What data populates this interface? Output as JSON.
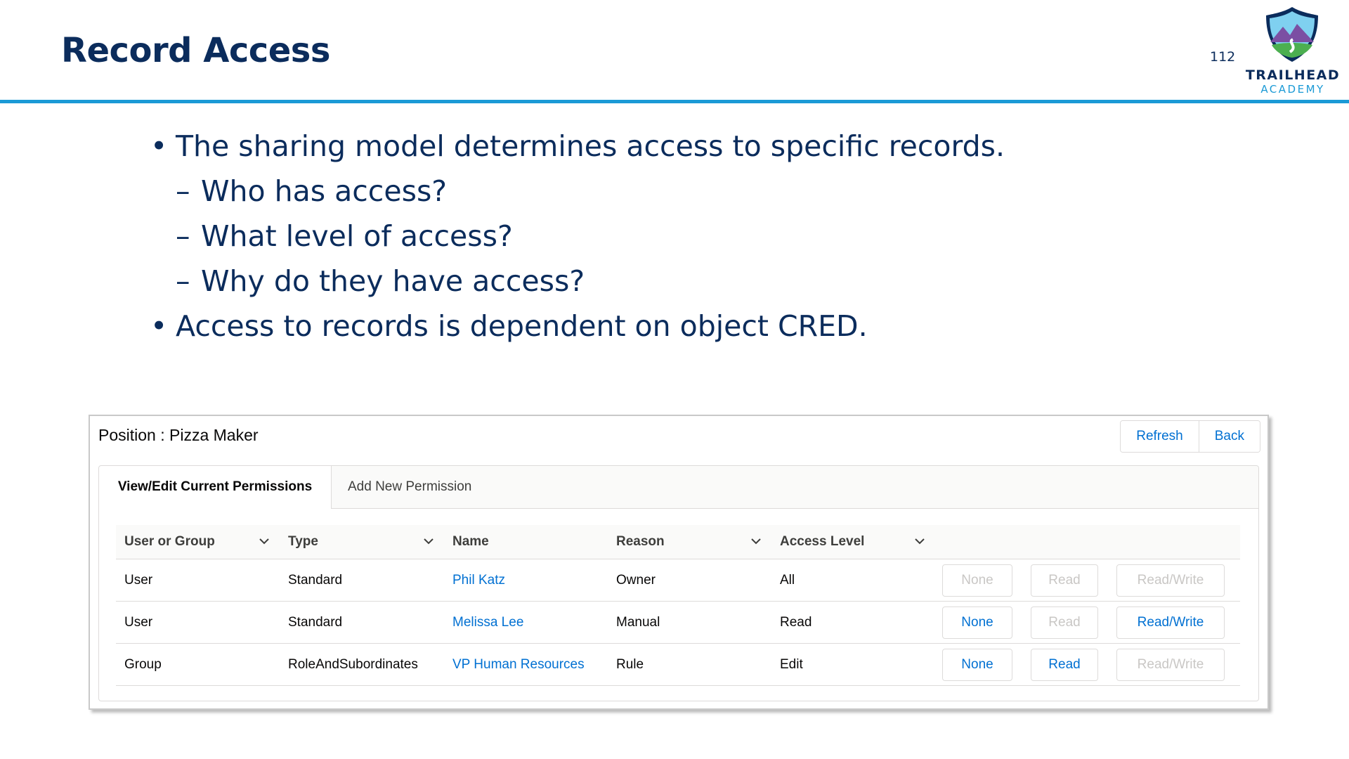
{
  "slide": {
    "title": "Record Access",
    "page_number": "112",
    "logo": {
      "line1": "TRAILHEAD",
      "line2": "ACADEMY",
      "icon": "trailhead-badge-icon"
    },
    "bullets": [
      {
        "level": 1,
        "marker": "•",
        "text": "The sharing model determines access to specific records."
      },
      {
        "level": 2,
        "marker": "–",
        "text": "Who has access?"
      },
      {
        "level": 2,
        "marker": "–",
        "text": "What level of access?"
      },
      {
        "level": 2,
        "marker": "–",
        "text": "Why do they have access?"
      },
      {
        "level": 1,
        "marker": "•",
        "text": "Access to records is dependent on object CRED."
      }
    ]
  },
  "panel": {
    "title": "Position : Pizza Maker",
    "buttons": {
      "refresh": "Refresh",
      "back": "Back"
    },
    "tabs": {
      "active": "View/Edit Current Permissions",
      "inactive": "Add New Permission"
    },
    "columns": [
      "User or Group",
      "Type",
      "Name",
      "Reason",
      "Access Level"
    ],
    "rows": [
      {
        "user_or_group": "User",
        "type": "Standard",
        "name": "Phil Katz",
        "reason": "Owner",
        "access_level": "All",
        "actions": [
          {
            "label": "None",
            "enabled": false
          },
          {
            "label": "Read",
            "enabled": false
          },
          {
            "label": "Read/Write",
            "enabled": false
          }
        ]
      },
      {
        "user_or_group": "User",
        "type": "Standard",
        "name": "Melissa Lee",
        "reason": "Manual",
        "access_level": "Read",
        "actions": [
          {
            "label": "None",
            "enabled": true
          },
          {
            "label": "Read",
            "enabled": false
          },
          {
            "label": "Read/Write",
            "enabled": true
          }
        ]
      },
      {
        "user_or_group": "Group",
        "type": "RoleAndSubordinates",
        "name": "VP Human Resources",
        "reason": "Rule",
        "access_level": "Edit",
        "actions": [
          {
            "label": "None",
            "enabled": true
          },
          {
            "label": "Read",
            "enabled": true
          },
          {
            "label": "Read/Write",
            "enabled": false
          }
        ]
      }
    ]
  },
  "colors": {
    "title": "#0b2c5c",
    "rule": "#1b9ad6",
    "link": "#0070d2",
    "disabled": "#c9c7c5"
  }
}
